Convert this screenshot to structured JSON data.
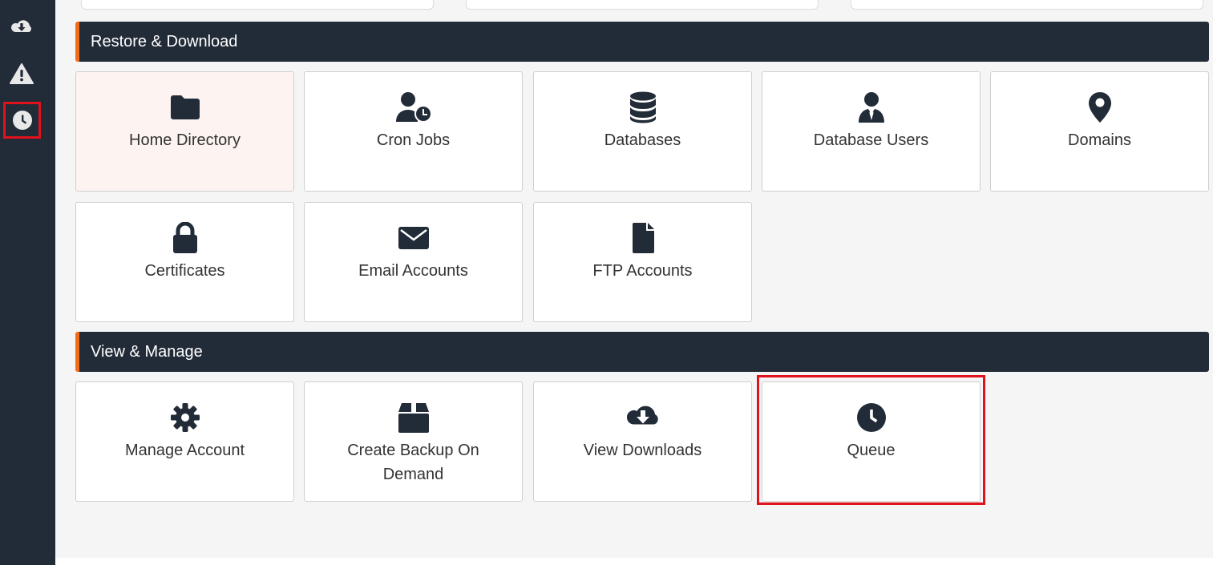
{
  "sidebar": {
    "items": [
      {
        "icon": "cloud-download-icon"
      },
      {
        "icon": "warning-icon"
      },
      {
        "icon": "clock-icon",
        "highlighted": true
      }
    ]
  },
  "sections": {
    "restore": {
      "title": "Restore & Download",
      "tiles": [
        {
          "label": "Home Directory",
          "icon": "folder-icon",
          "active": true
        },
        {
          "label": "Cron Jobs",
          "icon": "user-clock-icon"
        },
        {
          "label": "Databases",
          "icon": "database-icon"
        },
        {
          "label": "Database Users",
          "icon": "user-tie-icon"
        },
        {
          "label": "Domains",
          "icon": "map-marker-icon"
        },
        {
          "label": "Certificates",
          "icon": "lock-icon"
        },
        {
          "label": "Email Accounts",
          "icon": "envelope-icon"
        },
        {
          "label": "FTP Accounts",
          "icon": "file-icon"
        }
      ]
    },
    "manage": {
      "title": "View & Manage",
      "tiles": [
        {
          "label": "Manage Account",
          "icon": "gear-icon"
        },
        {
          "label": "Create Backup On Demand",
          "icon": "box-icon"
        },
        {
          "label": "View Downloads",
          "icon": "cloud-download-icon"
        },
        {
          "label": "Queue",
          "icon": "clock-icon",
          "highlighted": true
        }
      ]
    }
  },
  "colors": {
    "sidebar_bg": "#222b38",
    "accent": "#f26b1d",
    "highlight": "#e0121b",
    "icon": "#222b38"
  }
}
